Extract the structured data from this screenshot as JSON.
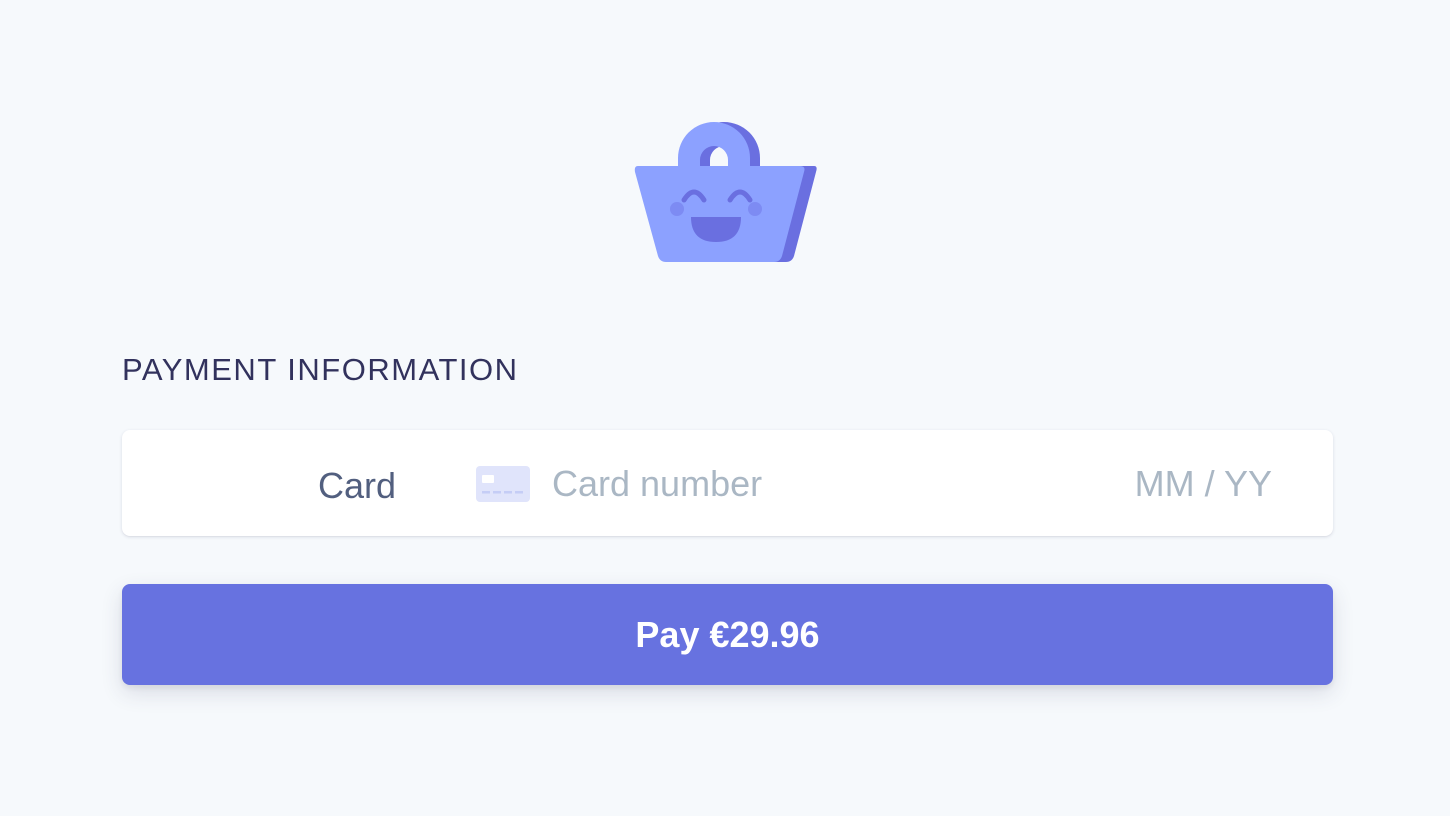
{
  "logo": {
    "icon": "smiling-shopping-basket-icon",
    "colors": {
      "body": "#8ca1ff",
      "shade": "#6a6fe0",
      "face": "#6a6fe0"
    }
  },
  "payment": {
    "title": "PAYMENT INFORMATION",
    "card_label": "Card",
    "card_icon": "credit-card-icon",
    "card_number_placeholder": "Card number",
    "expiry_placeholder": "MM / YY"
  },
  "pay_button": {
    "label": "Pay €29.96"
  },
  "colors": {
    "background": "#f6f9fc",
    "accent": "#6772e0",
    "title": "#32325d",
    "label": "#525f7f",
    "placeholder": "#aab7c4"
  }
}
